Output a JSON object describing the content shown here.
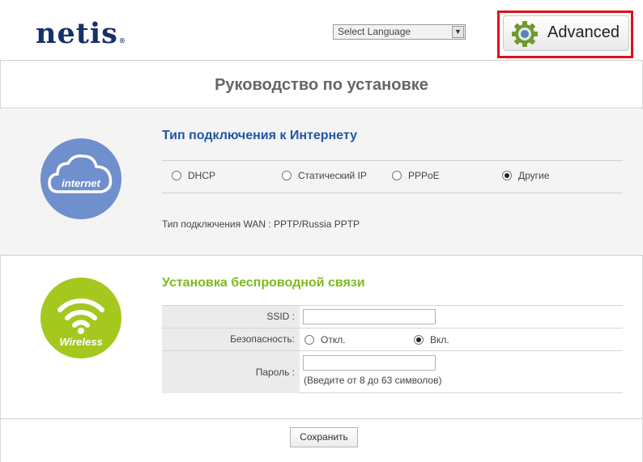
{
  "header": {
    "logo_text": "netis",
    "logo_mark": "®",
    "language_select": {
      "value": "Select Language"
    },
    "advanced_button": {
      "label": "Advanced",
      "icon": "gear-icon",
      "highlight_color": "#e0101a"
    }
  },
  "page": {
    "title": "Руководство по установке"
  },
  "internet": {
    "icon_label": "internet",
    "title": "Тип подключения к Интернету",
    "options": [
      {
        "label": "DHCP",
        "checked": false
      },
      {
        "label": "Статический IP",
        "checked": false
      },
      {
        "label": "PPPoE",
        "checked": false
      },
      {
        "label": "Другие",
        "checked": true
      }
    ],
    "wan_text": "Тип подключения WAN : PPTP/Russia PPTP"
  },
  "wireless": {
    "icon_label": "Wireless",
    "title": "Установка беспроводной связи",
    "ssid_label": "SSID :",
    "ssid_value": "",
    "security_label": "Безопасность:",
    "security_off": "Откл.",
    "security_on": "Вкл.",
    "security_checked": "on",
    "password_label": "Пароль :",
    "password_value": "",
    "password_hint": "(Введите от 8 до 63 символов)"
  },
  "footer": {
    "save_label": "Сохранить"
  },
  "colors": {
    "brand": "#14306e",
    "internet_blue": "#2156a5",
    "wireless_green": "#7cbb1c"
  }
}
